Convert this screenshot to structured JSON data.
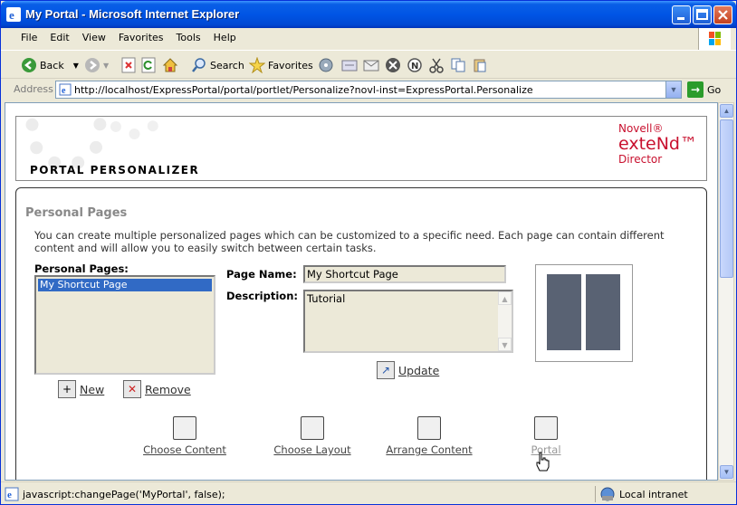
{
  "window": {
    "title": "My Portal - Microsoft Internet Explorer"
  },
  "menu": [
    "File",
    "Edit",
    "View",
    "Favorites",
    "Tools",
    "Help"
  ],
  "toolbar": {
    "back": "Back",
    "search": "Search",
    "favorites": "Favorites"
  },
  "address": {
    "label": "Address",
    "url": "http://localhost/ExpressPortal/portal/portlet/Personalize?novl-inst=ExpressPortal.Personalize",
    "go": "Go"
  },
  "banner": {
    "title": "PORTAL PERSONALIZER",
    "logo_line1": "Novell®",
    "logo_line2": "exteNd™",
    "logo_line3": "Director"
  },
  "section": {
    "title": "Personal Pages",
    "description": "You can create multiple personalized pages which can be customized to a specific need. Each page can contain different content and will allow you to easily switch between certain tasks."
  },
  "pages": {
    "list_label": "Personal Pages:",
    "items": [
      "My Shortcut Page"
    ],
    "new_label": "New",
    "remove_label": "Remove"
  },
  "form": {
    "page_name_label": "Page Name:",
    "page_name_value": "My Shortcut Page",
    "description_label": "Description:",
    "description_value": "Tutorial",
    "update_label": "Update"
  },
  "nav": {
    "choose_content": "Choose Content",
    "choose_layout": "Choose Layout",
    "arrange_content": "Arrange Content",
    "portal": "Portal"
  },
  "status": {
    "text": "javascript:changePage('MyPortal', false);",
    "zone": "Local intranet"
  }
}
